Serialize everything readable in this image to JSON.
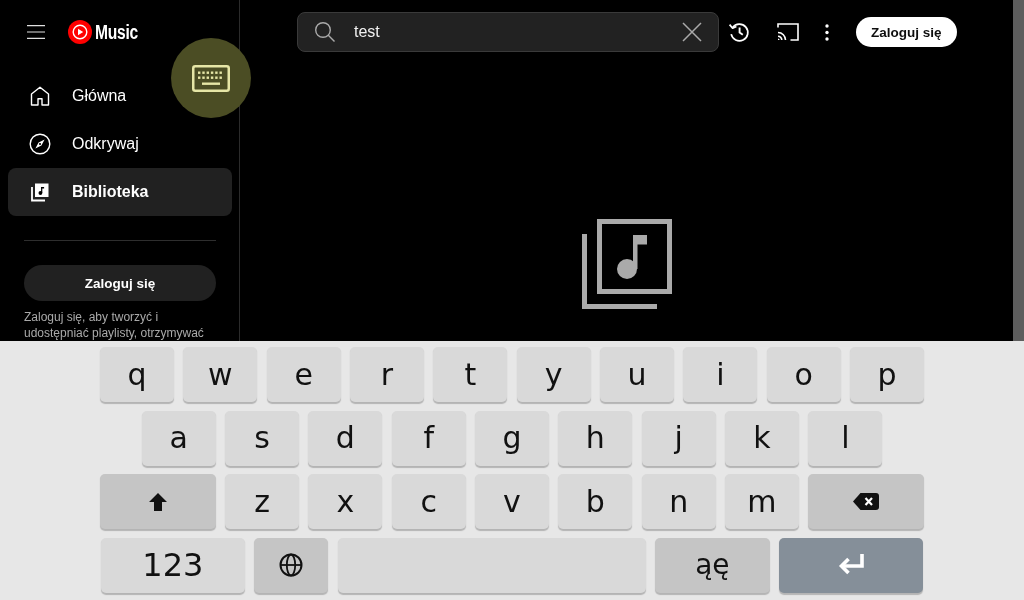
{
  "sidebar": {
    "logo_text": "Music",
    "nav_items": [
      {
        "kind": "home",
        "label": "Główna",
        "selected": false
      },
      {
        "kind": "explore",
        "label": "Odkrywaj",
        "selected": false
      },
      {
        "kind": "library",
        "label": "Biblioteka",
        "selected": true
      }
    ],
    "sign_in_button": "Zaloguj się",
    "sign_in_prompt": "Zaloguj się, aby tworzyć i udostępniać playlisty, otrzymywać"
  },
  "top_bar": {
    "search": {
      "value": "test"
    },
    "sign_in_button": "Zaloguj się"
  },
  "keyboard": {
    "rows": [
      [
        {
          "kind": "letter",
          "label": "q"
        },
        {
          "kind": "letter",
          "label": "w"
        },
        {
          "kind": "letter",
          "label": "e"
        },
        {
          "kind": "letter",
          "label": "r"
        },
        {
          "kind": "letter",
          "label": "t"
        },
        {
          "kind": "letter",
          "label": "y"
        },
        {
          "kind": "letter",
          "label": "u"
        },
        {
          "kind": "letter",
          "label": "i"
        },
        {
          "kind": "letter",
          "label": "o"
        },
        {
          "kind": "letter",
          "label": "p"
        }
      ],
      [
        {
          "kind": "letter",
          "label": "a"
        },
        {
          "kind": "letter",
          "label": "s"
        },
        {
          "kind": "letter",
          "label": "d"
        },
        {
          "kind": "letter",
          "label": "f"
        },
        {
          "kind": "letter",
          "label": "g"
        },
        {
          "kind": "letter",
          "label": "h"
        },
        {
          "kind": "letter",
          "label": "j"
        },
        {
          "kind": "letter",
          "label": "k"
        },
        {
          "kind": "letter",
          "label": "l"
        }
      ],
      [
        {
          "kind": "shift"
        },
        {
          "kind": "letter",
          "label": "z"
        },
        {
          "kind": "letter",
          "label": "x"
        },
        {
          "kind": "letter",
          "label": "c"
        },
        {
          "kind": "letter",
          "label": "v"
        },
        {
          "kind": "letter",
          "label": "b"
        },
        {
          "kind": "letter",
          "label": "n"
        },
        {
          "kind": "letter",
          "label": "m"
        },
        {
          "kind": "backspace"
        }
      ],
      [
        {
          "kind": "symbols",
          "label": "123"
        },
        {
          "kind": "globe"
        },
        {
          "kind": "space"
        },
        {
          "kind": "accents",
          "label": "ąę"
        },
        {
          "kind": "enter"
        }
      ]
    ]
  }
}
